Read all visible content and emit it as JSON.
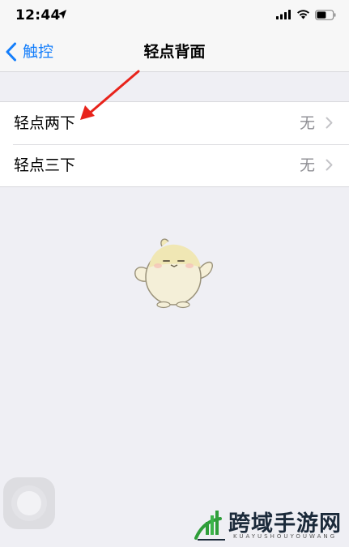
{
  "status_bar": {
    "time": "12:44",
    "icons": [
      "location-arrow-icon",
      "cellular-signal-icon",
      "wifi-icon",
      "battery-icon"
    ]
  },
  "nav": {
    "back_label": "触控",
    "title": "轻点背面"
  },
  "list": {
    "rows": [
      {
        "label": "轻点两下",
        "value": "无"
      },
      {
        "label": "轻点三下",
        "value": "无"
      }
    ]
  },
  "watermark": {
    "logo_text": "跨域手游网",
    "logo_sub": "KUAYUSHOUYOUWANG"
  },
  "colors": {
    "accent": "#147efb",
    "background": "#efeff4",
    "annotation": "#e8231b"
  }
}
